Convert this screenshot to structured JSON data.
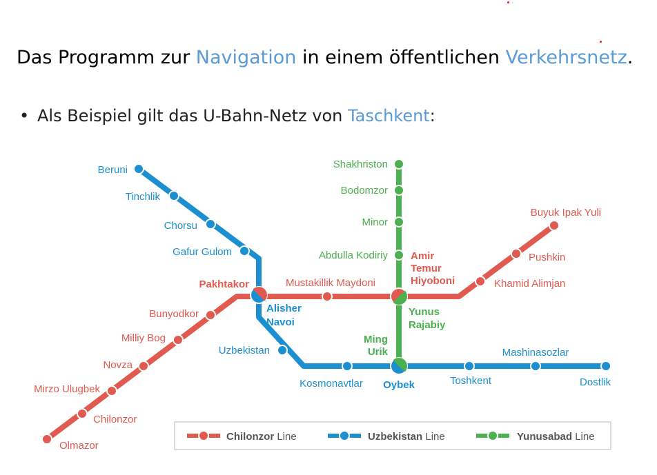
{
  "heading": {
    "part1": "Das Programm zur ",
    "link1": "Navigation",
    "part2": " in einem öffentlichen ",
    "link2": "Verkehrsnetz",
    "part3": "."
  },
  "bullet": {
    "marker": "•",
    "text": "Als Beispiel gilt das U-Bahn-Netz von ",
    "link": "Taschkent",
    "end": ":"
  },
  "colors": {
    "red": "#e05a50",
    "blue": "#1b8fcf",
    "green": "#4caf50",
    "accent_text": "#5b9bd5"
  },
  "stations": {
    "blue": {
      "beruni": "Beruni",
      "tinchlik": "Tinchlik",
      "chorsu": "Chorsu",
      "gafur": "Gafur Gulom",
      "alisher1": "Alisher",
      "alisher2": "Navoi",
      "uzbekistan": "Uzbekistan",
      "kosmonavtlar": "Kosmonavtlar",
      "oybek": "Oybek",
      "toshkent": "Toshkent",
      "mashinasozlar": "Mashinasozlar",
      "dostlik": "Dostlik"
    },
    "red": {
      "olmazor": "Olmazor",
      "chilonzor": "Chilonzor",
      "mirzo": "Mirzo Ulugbek",
      "novza": "Novza",
      "milliy": "Milliy Bog",
      "bunyodkor": "Bunyodkor",
      "pakhtakor": "Pakhtakor",
      "mustakillik": "Mustakillik Maydoni",
      "amir1": "Amir",
      "amir2": "Temur",
      "amir3": "Hiyoboni",
      "khamid": "Khamid Alimjan",
      "pushkin": "Pushkin",
      "buyuk": "Buyuk Ipak Yuli"
    },
    "green": {
      "shakhriston": "Shakhriston",
      "bodomzor": "Bodomzor",
      "minor": "Minor",
      "abdulla": "Abdulla Kodiriy",
      "yunus1": "Yunus",
      "yunus2": "Rajabiy",
      "ming1": "Ming",
      "ming2": "Urik"
    }
  },
  "legend": [
    {
      "name": "Chilonzor",
      "suffix": " Line"
    },
    {
      "name": "Uzbekistan",
      "suffix": " Line"
    },
    {
      "name": "Yunusabad",
      "suffix": " Line"
    }
  ]
}
